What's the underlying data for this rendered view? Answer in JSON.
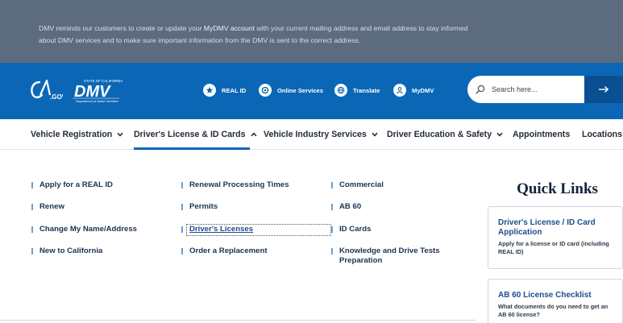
{
  "notice": {
    "text_before": "DMV reminds our customers to create or update your ",
    "link": "MyDMV account",
    "text_after": " with your current mailing address and email address to stay informed about DMV services and to make sure important information from the DMV is sent to the correct address."
  },
  "header": {
    "ca_logo_text": "CA.GOV",
    "dmv_logo_text": "DMV",
    "dmv_logo_top": "STATE OF CALIFORNIA",
    "dmv_logo_bottom": "Department of Motor Vehicles",
    "utility_links": [
      {
        "label": "REAL ID",
        "icon": "star-icon"
      },
      {
        "label": "Online Services",
        "icon": "online-services-icon"
      },
      {
        "label": "Translate",
        "icon": "globe-icon"
      },
      {
        "label": "MyDMV",
        "icon": "user-icon"
      }
    ],
    "search_placeholder": "Search here...",
    "accent_color": "#0b67b6"
  },
  "nav": {
    "items": [
      {
        "label": "Vehicle Registration",
        "expanded": false
      },
      {
        "label": "Driver's License & ID Cards",
        "expanded": true
      },
      {
        "label": "Vehicle Industry Services",
        "expanded": false
      },
      {
        "label": "Driver Education & Safety",
        "expanded": false
      },
      {
        "label": "Appointments"
      },
      {
        "label": "Locations"
      }
    ]
  },
  "dropdown": {
    "col1": [
      "Apply for a REAL ID",
      "Renew",
      "Change My Name/Address",
      "New to California"
    ],
    "col2": [
      "Renewal Processing Times",
      "Permits",
      "Driver's Licenses",
      "Order a Replacement"
    ],
    "col3": [
      "Commercial",
      "AB 60",
      "ID Cards",
      "Knowledge and Drive Tests Preparation"
    ]
  },
  "quick_links": {
    "title": "Quick Links",
    "cards": [
      {
        "title": "Driver's License / ID Card Application",
        "desc": "Apply for a license or ID card (including REAL ID)"
      },
      {
        "title": "AB 60 License Checklist",
        "desc": "What documents do you need to get an AB 60 license?"
      }
    ]
  }
}
